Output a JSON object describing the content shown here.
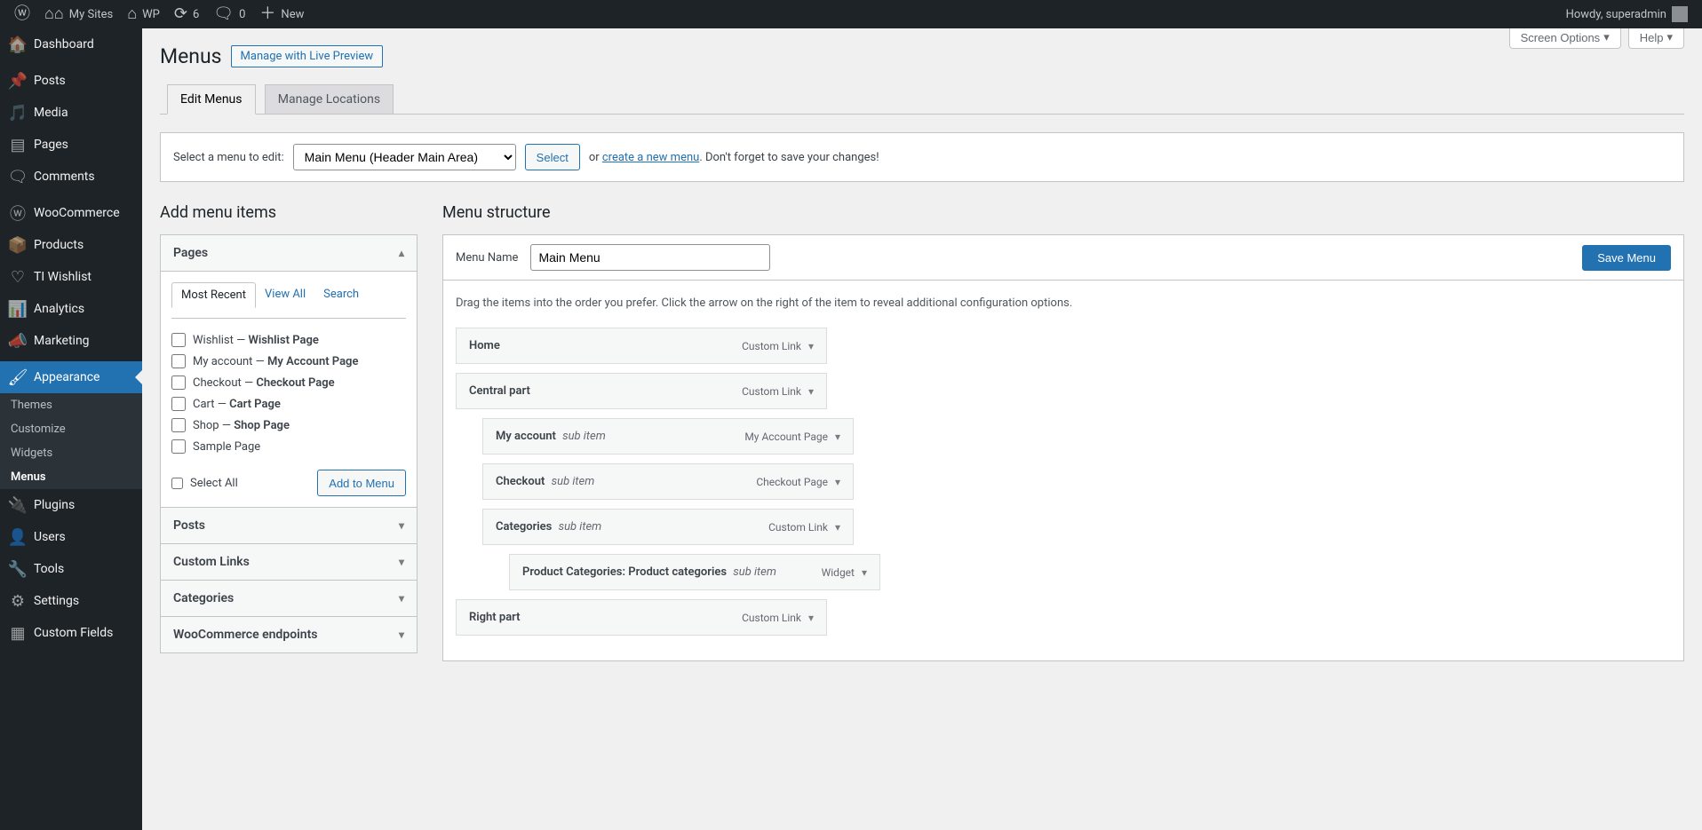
{
  "adminBar": {
    "mySites": "My Sites",
    "siteName": "WP",
    "updates": "6",
    "comments": "0",
    "new": "New",
    "howdy": "Howdy, superadmin"
  },
  "sidebar": {
    "dashboard": "Dashboard",
    "posts": "Posts",
    "media": "Media",
    "pages": "Pages",
    "comments": "Comments",
    "woocommerce": "WooCommerce",
    "products": "Products",
    "wishlist": "TI Wishlist",
    "analytics": "Analytics",
    "marketing": "Marketing",
    "appearance": "Appearance",
    "appearanceSub": {
      "themes": "Themes",
      "customize": "Customize",
      "widgets": "Widgets",
      "menus": "Menus"
    },
    "plugins": "Plugins",
    "users": "Users",
    "tools": "Tools",
    "settings": "Settings",
    "customFields": "Custom Fields"
  },
  "screenOptions": "Screen Options",
  "help": "Help",
  "page": {
    "title": "Menus",
    "liveBtn": "Manage with Live Preview",
    "tabs": {
      "edit": "Edit Menus",
      "locations": "Manage Locations"
    },
    "selectPrompt": "Select a menu to edit:",
    "selectedMenu": "Main Menu (Header Main Area)",
    "selectBtn": "Select",
    "orText": "or",
    "createLink": "create a new menu",
    "dontForget": ". Don't forget to save your changes!"
  },
  "addItems": {
    "heading": "Add menu items",
    "pages": "Pages",
    "posts": "Posts",
    "customLinks": "Custom Links",
    "categories": "Categories",
    "wooEndpoints": "WooCommerce endpoints",
    "subTabs": {
      "recent": "Most Recent",
      "viewAll": "View All",
      "search": "Search"
    },
    "pageList": [
      {
        "label": "Wishlist",
        "suffix": "Wishlist Page"
      },
      {
        "label": "My account",
        "suffix": "My Account Page"
      },
      {
        "label": "Checkout",
        "suffix": "Checkout Page"
      },
      {
        "label": "Cart",
        "suffix": "Cart Page"
      },
      {
        "label": "Shop",
        "suffix": "Shop Page"
      },
      {
        "label": "Sample Page",
        "suffix": ""
      }
    ],
    "selectAll": "Select All",
    "addToMenu": "Add to Menu"
  },
  "structure": {
    "heading": "Menu structure",
    "menuNameLabel": "Menu Name",
    "menuNameValue": "Main Menu",
    "saveBtn": "Save Menu",
    "helpText": "Drag the items into the order you prefer. Click the arrow on the right of the item to reveal additional configuration options.",
    "items": [
      {
        "title": "Home",
        "type": "Custom Link",
        "depth": 0
      },
      {
        "title": "Central part",
        "type": "Custom Link",
        "depth": 0
      },
      {
        "title": "My account",
        "type": "My Account Page",
        "depth": 1,
        "sub": true
      },
      {
        "title": "Checkout",
        "type": "Checkout Page",
        "depth": 1,
        "sub": true
      },
      {
        "title": "Categories",
        "type": "Custom Link",
        "depth": 1,
        "sub": true
      },
      {
        "title": "Product Categories: Product categories",
        "type": "Widget",
        "depth": 2,
        "sub": true
      },
      {
        "title": "Right part",
        "type": "Custom Link",
        "depth": 0
      }
    ],
    "subLabel": "sub item"
  }
}
